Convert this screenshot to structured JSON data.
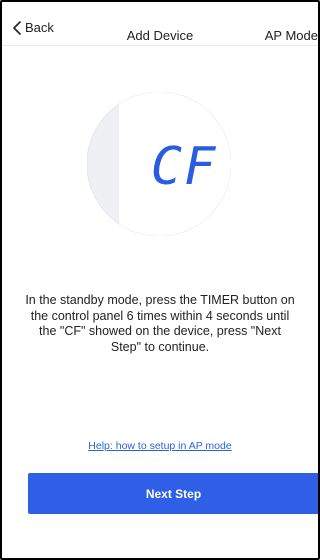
{
  "header": {
    "back_label": "Back",
    "title": "Add Device",
    "ap_mode_label": "AP Mode"
  },
  "illustration": {
    "display_text": "CF",
    "display_color": "#2a5ce0",
    "circle_color": "#eef0f4",
    "panel_color": "#ffffff"
  },
  "instruction": "In the standby mode, press the TIMER button on the control panel 6 times within 4 seconds until the \"CF\" showed on the device, press \"Next Step\" to continue.",
  "help_link": "Help: how to setup in AP mode",
  "next_button": "Next Step",
  "colors": {
    "accent": "#2e5fe6",
    "link": "#2b63d9"
  }
}
